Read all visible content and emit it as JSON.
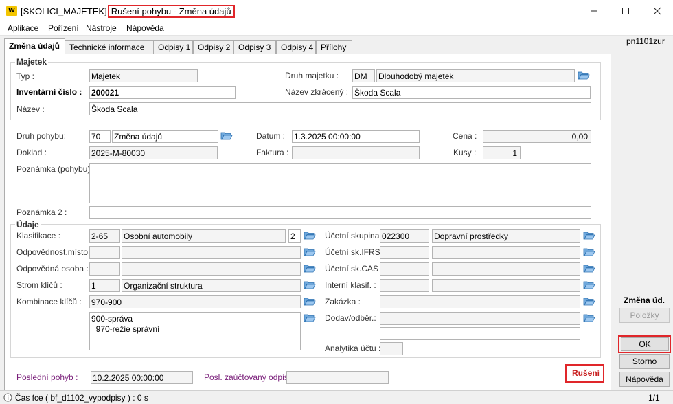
{
  "window": {
    "title_prefix": "[SKOLICI_MAJETEK]",
    "title_highlight": "Rušení pohybu - Změna údajů",
    "logo": "W",
    "minimize_icon": "minimize-icon",
    "maximize_icon": "maximize-icon",
    "close_icon": "close-icon"
  },
  "menu": [
    "Aplikace",
    "Pořízení",
    "Nástroje",
    "Nápověda"
  ],
  "tabs": [
    "Změna údajů",
    "Technické informace",
    "Odpisy 1",
    "Odpisy 2",
    "Odpisy 3",
    "Odpisy 4",
    "Přílohy"
  ],
  "form_id": "pn1101zur",
  "majetek": {
    "section_title": "Majetek",
    "typ_label": "Typ :",
    "typ_value": "Majetek",
    "druh_label": "Druh majetku :",
    "druh_code": "DM",
    "druh_value": "Dlouhodobý majetek",
    "inv_label": "Inventární číslo :",
    "inv_value": "200021",
    "nazev_zkr_label": "Název zkrácený :",
    "nazev_zkr_value": "Škoda Scala",
    "nazev_label": "Název :",
    "nazev_value": "Škoda Scala"
  },
  "pohyb": {
    "druh_label": "Druh pohybu:",
    "druh_code": "70",
    "druh_value": "Změna údajů",
    "datum_label": "Datum :",
    "datum_value": "1.3.2025 00:00:00",
    "cena_label": "Cena :",
    "cena_value": "0,00",
    "doklad_label": "Doklad :",
    "doklad_value": "2025-M-80030",
    "faktura_label": "Faktura :",
    "faktura_value": "",
    "kusy_label": "Kusy :",
    "kusy_value": "1",
    "poznamka_label": "Poznámka (pohybu) :",
    "poznamka_value": "",
    "poznamka2_label": "Poznámka 2 :",
    "poznamka2_value": ""
  },
  "udaje": {
    "section_title": "Údaje",
    "klasifikace_label": "Klasifikace :",
    "klasifikace_code": "2-65",
    "klasifikace_value": "Osobní automobily",
    "klasifikace_num": "2",
    "odp_misto_label": "Odpovědnost.místo :",
    "odp_osoba_label": "Odpovědná osoba :",
    "strom_label": "Strom klíčů :",
    "strom_code": "1",
    "strom_value": "Organizační struktura",
    "kombinace_label": "Kombinace klíčů :",
    "kombinace_value": "970-900",
    "kombinace_detail": "900-správa\n  970-režie správní",
    "ucetni_skupina_label": "Účetní skupina :",
    "ucetni_skupina_code": "022300",
    "ucetni_skupina_value": "Dopravní prostředky",
    "ifrs_label": "Účetní sk.IFRS :",
    "cas_label": "Účetní sk.CAS :",
    "interni_label": "Interní klasif. :",
    "zakazka_label": "Zakázka :",
    "dodav_label": "Dodav/odběr.:",
    "analytika_label": "Analytika účtu :"
  },
  "bottom": {
    "posledni_label": "Poslední pohyb :",
    "posledni_value": "10.2.2025 00:00:00",
    "posl_odpis_label": "Posl. zaúčtovaný odpis :",
    "posl_odpis_value": "",
    "ruseni_label": "Rušení"
  },
  "side": {
    "title": "Změna úd.",
    "polozky": "Položky",
    "ok": "OK",
    "storno": "Storno",
    "napoveda": "Nápověda"
  },
  "status": {
    "text": "Čas fce ( bf_d1102_vypodpisy ) : 0 s",
    "page": "1/1",
    "info_icon": "info-icon"
  },
  "colors": {
    "highlight": "#e0262a",
    "folder": "#3a86c8",
    "accent_label": "#7a1f7a"
  }
}
